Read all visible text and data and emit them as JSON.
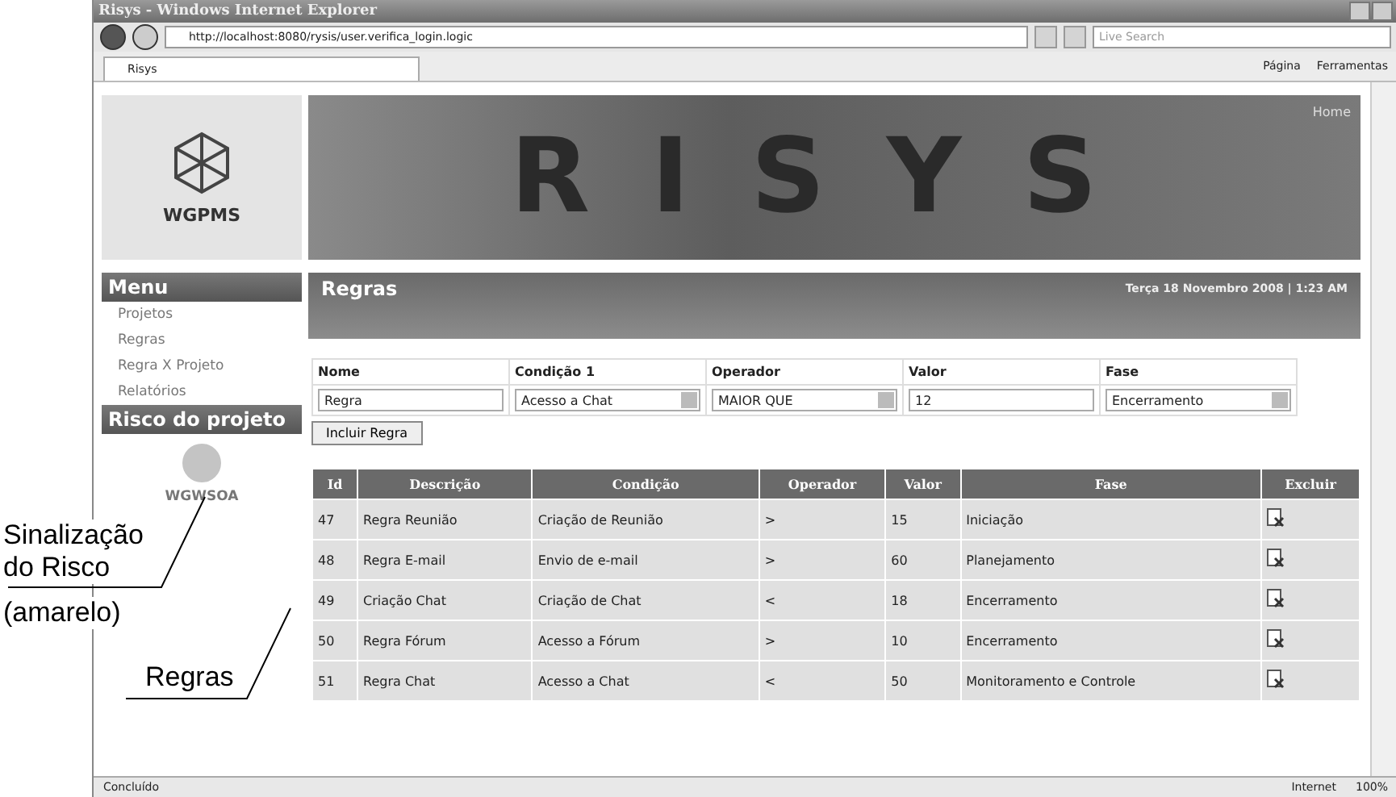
{
  "window": {
    "title": "Risys - Windows Internet Explorer"
  },
  "address_bar": {
    "url": "http://localhost:8080/rysis/user.verifica_login.logic",
    "search_placeholder": "Live Search"
  },
  "tab": {
    "label": "Risys"
  },
  "command_bar": [
    "Página",
    "Ferramentas"
  ],
  "header": {
    "logo": "WGPMS",
    "banner": "RISYS",
    "home": "Home"
  },
  "sidebar": {
    "menu_title": "Menu",
    "items": [
      "Projetos",
      "Regras",
      "Regra X Projeto",
      "Relatórios"
    ],
    "risk_title": "Risco do projeto",
    "risk_indicator": {
      "color": "#c4c4c4"
    },
    "project": "WGWSOA"
  },
  "page": {
    "title": "Regras",
    "date": "Terça 18 Novembro 2008 | 1:23 AM"
  },
  "form": {
    "fields": [
      {
        "label": "Nome",
        "kind": "text",
        "value": "Regra"
      },
      {
        "label": "Condição 1",
        "kind": "select",
        "value": "Acesso a Chat"
      },
      {
        "label": "Operador",
        "kind": "select",
        "value": "MAIOR QUE"
      },
      {
        "label": "Valor",
        "kind": "text",
        "value": "12"
      },
      {
        "label": "Fase",
        "kind": "select",
        "value": "Encerramento"
      }
    ],
    "button": "Incluir Regra"
  },
  "table": {
    "columns": [
      "Id",
      "Descrição",
      "Condição",
      "Operador",
      "Valor",
      "Fase",
      "Excluir"
    ],
    "rows": [
      [
        "47",
        "Regra Reunião",
        "Criação de Reunião",
        ">",
        "15",
        "Iniciação"
      ],
      [
        "48",
        "Regra E-mail",
        "Envio de e-mail",
        ">",
        "60",
        "Planejamento"
      ],
      [
        "49",
        "Criação Chat",
        "Criação de Chat",
        "<",
        "18",
        "Encerramento"
      ],
      [
        "50",
        "Regra Fórum",
        "Acesso a Fórum",
        ">",
        "10",
        "Encerramento"
      ],
      [
        "51",
        "Regra Chat",
        "Acesso a Chat",
        "<",
        "50",
        "Monitoramento e Controle"
      ]
    ]
  },
  "status_bar": {
    "status": "Concluído",
    "zone": "Internet",
    "zoom": "100%"
  },
  "annotations": [
    "Sinalização do Risco",
    "(amarelo)",
    "Regras"
  ]
}
